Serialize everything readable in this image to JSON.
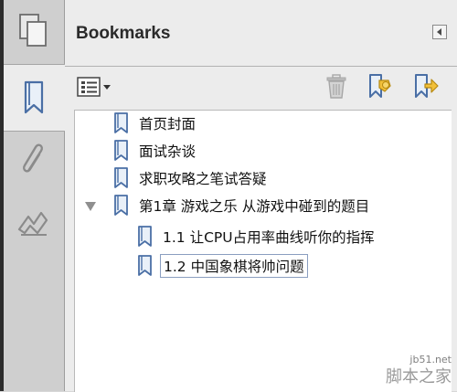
{
  "panel": {
    "title": "Bookmarks"
  },
  "rail": {
    "items": [
      {
        "name": "pages",
        "icon": "pages-icon"
      },
      {
        "name": "bookmarks",
        "icon": "bookmark-icon",
        "active": true
      },
      {
        "name": "attachments",
        "icon": "paperclip-icon"
      },
      {
        "name": "signatures",
        "icon": "signature-icon"
      }
    ]
  },
  "toolbar": {
    "buttons": [
      "options-menu-icon",
      "trash-icon",
      "new-bookmark-icon",
      "expand-bookmark-icon"
    ]
  },
  "bookmarks": [
    {
      "label": "首页封面",
      "level": 0
    },
    {
      "label": "面试杂谈",
      "level": 0
    },
    {
      "label": "求职攻略之笔试答疑",
      "level": 0
    },
    {
      "label": "第1章 游戏之乐 从游戏中碰到的题目",
      "level": 0,
      "expanded": true
    },
    {
      "label": "1.1 让CPU占用率曲线听你的指挥",
      "level": 1
    },
    {
      "label": "1.2 中国象棋将帅问题",
      "level": 1,
      "selected": true
    }
  ],
  "watermark": {
    "url": "jb51.net",
    "name": "脚本之家"
  },
  "colors": {
    "panel_bg": "#ececec",
    "list_bg": "#ffffff",
    "icon_blue": "#4a6fa5",
    "selection_border": "#8a9ec0"
  }
}
